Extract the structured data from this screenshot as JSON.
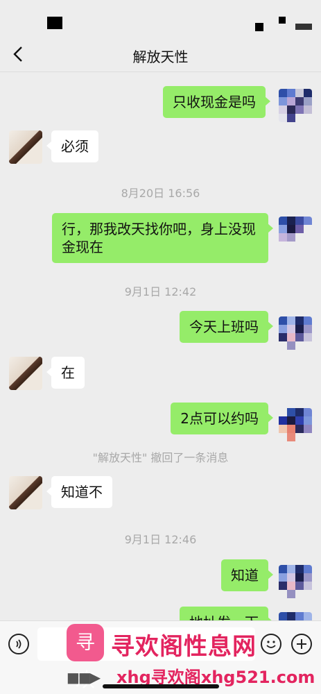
{
  "header": {
    "title": "解放天性"
  },
  "messages": {
    "m1": "只收现金是吗",
    "m2": "必须",
    "t1": "8月20日 16:56",
    "m3": "行，那我改天找你吧，身上没现金现在",
    "t2": "9月1日 12:42",
    "m4": "今天上班吗",
    "m5": "在",
    "m6": "2点可以约吗",
    "recall": "\"解放天性\" 撤回了一条消息",
    "m7": "知道不",
    "t3": "9月1日 12:46",
    "m8": "知道",
    "m9": "地址发一下"
  },
  "watermark": {
    "logo": "寻欢",
    "text": "寻欢阁性息网",
    "url": "xhg寻欢阁xhg521.com"
  },
  "colors": {
    "my_bubble": "#95ec69",
    "their_bubble": "#ffffff",
    "background": "#ededed"
  },
  "icons": {
    "back": "chevron-left-icon",
    "voice": "voice-icon",
    "emoji": "emoji-icon",
    "plus": "plus-icon"
  }
}
